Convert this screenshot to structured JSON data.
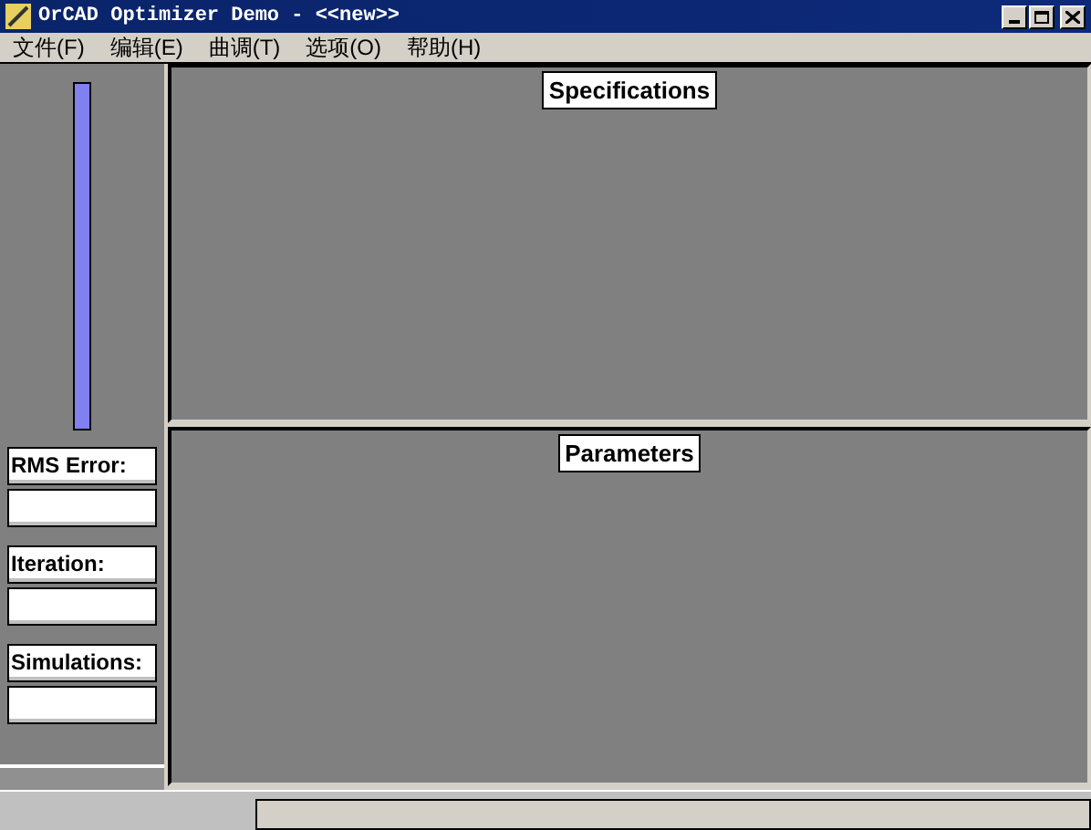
{
  "window": {
    "title": "OrCAD Optimizer Demo - <<new>>"
  },
  "menu": [
    "文件(F)",
    "编辑(E)",
    "曲调(T)",
    "选项(O)",
    "帮助(H)"
  ],
  "progress": {
    "level": 1
  },
  "fields": [
    {
      "label": "RMS Error:"
    },
    {
      "label": "Iteration:"
    },
    {
      "label": "Simulations:"
    }
  ],
  "panels": [
    {
      "title": "Specifications"
    },
    {
      "title": "Parameters"
    }
  ]
}
